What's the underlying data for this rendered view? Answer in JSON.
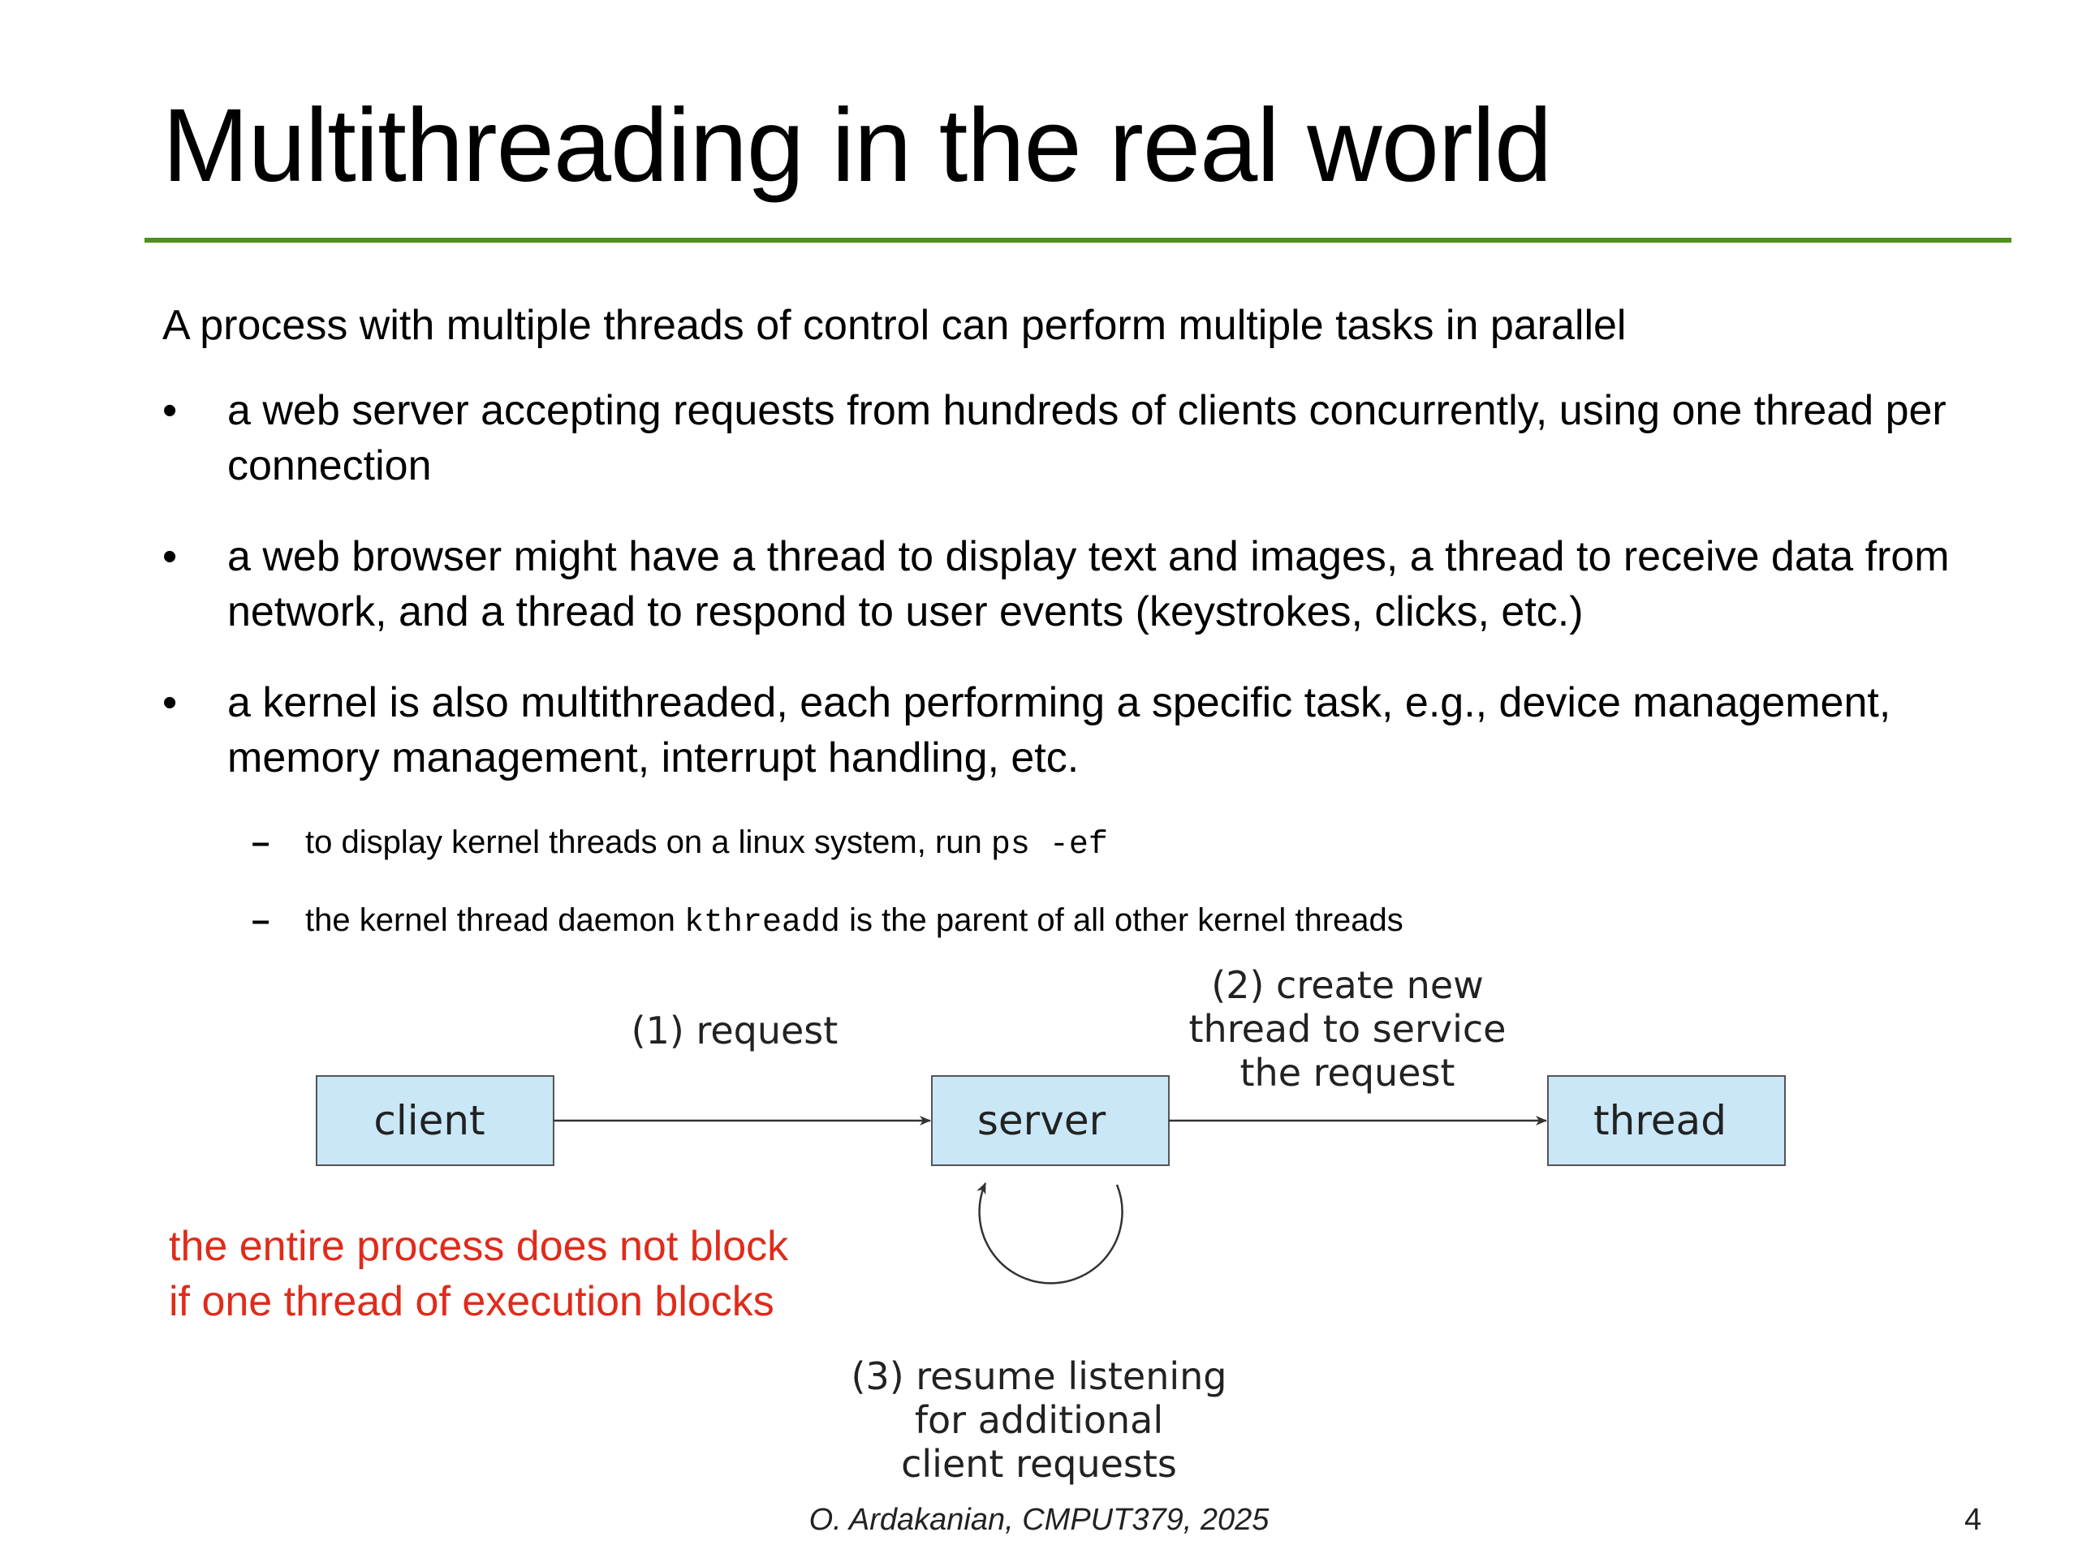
{
  "slide": {
    "title": "Multithreading in the real world",
    "lead": "A process with multiple threads of control can perform multiple tasks in parallel",
    "bullet_symbol": "•",
    "sub_symbol": "–",
    "bullets": [
      {
        "text": "a web server accepting requests from hundreds of clients concurrently, using one thread per connection"
      },
      {
        "text": "a web browser might have a thread to display text and images, a thread to receive data from network, and a thread to respond to user events (keystrokes, clicks, etc.)"
      },
      {
        "text": "a kernel is also multithreaded, each performing a specific task, e.g., device management, memory management, interrupt handling, etc."
      }
    ],
    "subbullets": [
      {
        "before": "to display kernel threads on a linux system, run ",
        "code": "ps -ef",
        "after": ""
      },
      {
        "before": "the kernel thread daemon ",
        "code": "kthreadd",
        "after": " is the parent of all other kernel threads"
      }
    ],
    "note_lines": [
      "the entire process does not block",
      "if one thread of execution blocks"
    ],
    "footer": "O. Ardakanian, CMPUT379, 2025",
    "page_number": "4"
  },
  "diagram": {
    "nodes": {
      "client": "client",
      "server": "server",
      "thread": "thread"
    },
    "step1": "(1) request",
    "step2_lines": [
      "(2) create new",
      "thread to service",
      "the request"
    ],
    "step3_lines": [
      "(3) resume listening",
      "for additional",
      "client requests"
    ]
  },
  "colors": {
    "title_rule": "#4f8f1b",
    "node_fill": "#c9e7f7",
    "node_stroke": "#555555",
    "note_text": "#e02b1b"
  }
}
